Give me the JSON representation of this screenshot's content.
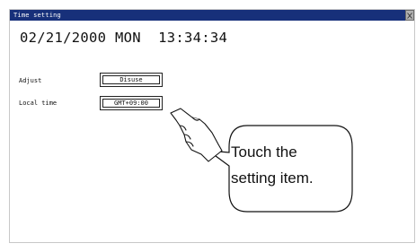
{
  "window": {
    "title": "Time setting"
  },
  "clock": {
    "date": "02/21/2000",
    "day": "MON",
    "time": "13:34:34",
    "display": "02/21/2000 MON  13:34:34"
  },
  "settings": [
    {
      "label": "Adjust",
      "value": "Disuse"
    },
    {
      "label": "Local time",
      "value": "GMT+09:00"
    }
  ],
  "callout": {
    "line1": "Touch the",
    "line2": "setting item."
  },
  "colors": {
    "titlebar": "#17307a",
    "close_button": "#b0b0b0"
  },
  "icons": {
    "close": "close-icon",
    "hand": "pointing-hand-icon"
  }
}
